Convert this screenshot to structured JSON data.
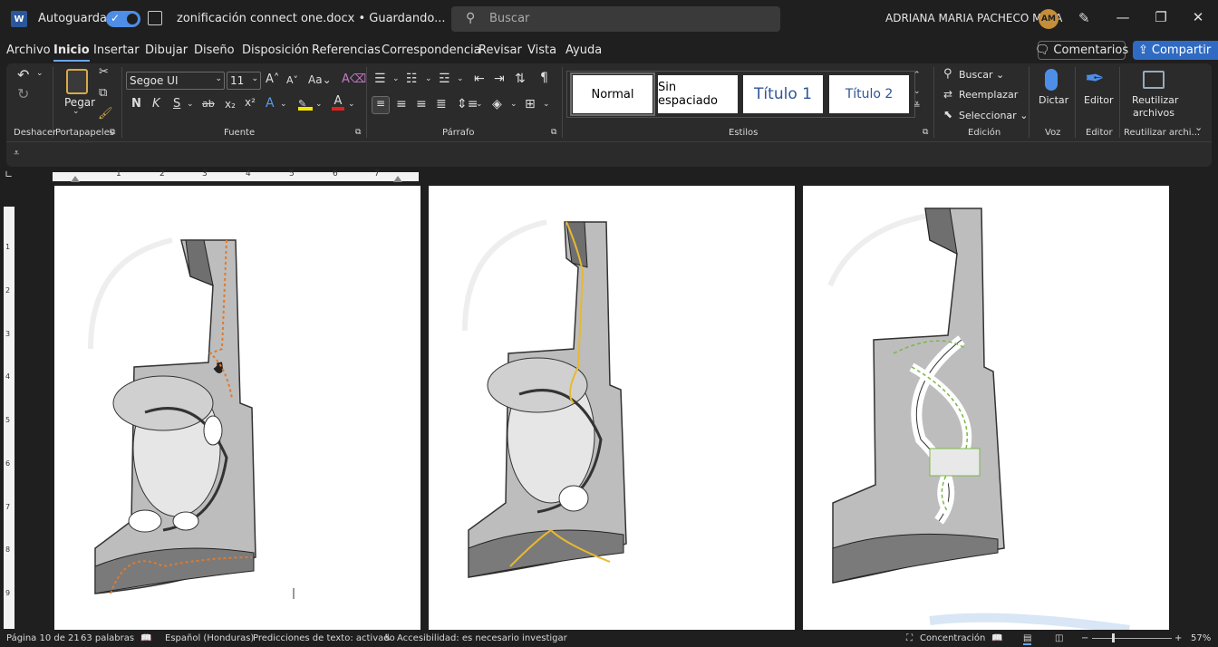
{
  "title_bar": {
    "autosave_label": "Autoguardado",
    "document_title": "zonificación connect one.docx • Guardando...",
    "search_placeholder": "Buscar",
    "user_name": "ADRIANA MARIA PACHECO MEJIA",
    "user_initials": "AM"
  },
  "menu": {
    "tabs": [
      "Archivo",
      "Inicio",
      "Insertar",
      "Dibujar",
      "Diseño",
      "Disposición",
      "Referencias",
      "Correspondencia",
      "Revisar",
      "Vista",
      "Ayuda"
    ],
    "active_tab": "Inicio",
    "comments_label": "Comentarios",
    "share_label": "Compartir"
  },
  "ribbon": {
    "groups": {
      "undo": "Deshacer",
      "clipboard": "Portapapeles",
      "font": "Fuente",
      "paragraph": "Párrafo",
      "styles": "Estilos",
      "editing": "Edición",
      "voice": "Voz",
      "editor": "Editor",
      "reuse": "Reutilizar archi..."
    },
    "paste_label": "Pegar",
    "font_name": "Segoe UI",
    "font_size": "11",
    "case_label": "Aa",
    "bold": "N",
    "italic": "K",
    "underline": "S",
    "strike": "ab",
    "styles": [
      "Normal",
      "Sin espaciado",
      "Título 1",
      "Título 2"
    ],
    "find_label": "Buscar",
    "replace_label": "Reemplazar",
    "select_label": "Seleccionar",
    "dictate_label": "Dictar",
    "editor_label": "Editor",
    "reuse_label_1": "Reutilizar",
    "reuse_label_2": "archivos"
  },
  "ruler_numbers": [
    "1",
    "2",
    "3",
    "4",
    "5",
    "6",
    "7"
  ],
  "vruler_numbers": [
    "1",
    "2",
    "3",
    "4",
    "5",
    "6",
    "7",
    "8",
    "9"
  ],
  "status_bar": {
    "page": "Página 10 de 21",
    "words": "63 palabras",
    "language": "Español (Honduras)",
    "predictions": "Predicciones de texto: activado",
    "accessibility": "Accesibilidad: es necesario investigar",
    "focus": "Concentración",
    "zoom": "57%"
  },
  "colors": {
    "accent": "#2f6bc3",
    "route_orange": "#e07a2c",
    "route_yellow": "#e8b830",
    "route_green": "#7ab848"
  }
}
